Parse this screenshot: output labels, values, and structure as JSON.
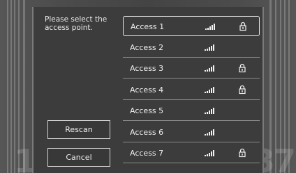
{
  "prompt": "Please select the access point.",
  "buttons": {
    "rescan": "Rescan",
    "cancel": "Cancel"
  },
  "access_points": [
    {
      "name": "Access 1",
      "secured": true,
      "selected": true,
      "signal_bars": 5
    },
    {
      "name": "Access 2",
      "secured": false,
      "selected": false,
      "signal_bars": 5
    },
    {
      "name": "Access 3",
      "secured": true,
      "selected": false,
      "signal_bars": 5
    },
    {
      "name": "Access 4",
      "secured": true,
      "selected": false,
      "signal_bars": 5
    },
    {
      "name": "Access 5",
      "secured": false,
      "selected": false,
      "signal_bars": 5
    },
    {
      "name": "Access 6",
      "secured": false,
      "selected": false,
      "signal_bars": 5
    },
    {
      "name": "Access 7",
      "secured": true,
      "selected": false,
      "signal_bars": 5
    }
  ],
  "colors": {
    "panel": "#3c3c3c",
    "text": "#f0f0f0",
    "divider": "#8a8a8a"
  },
  "icons": {
    "signal": "signal-strength-icon",
    "lock": "lock-icon"
  }
}
